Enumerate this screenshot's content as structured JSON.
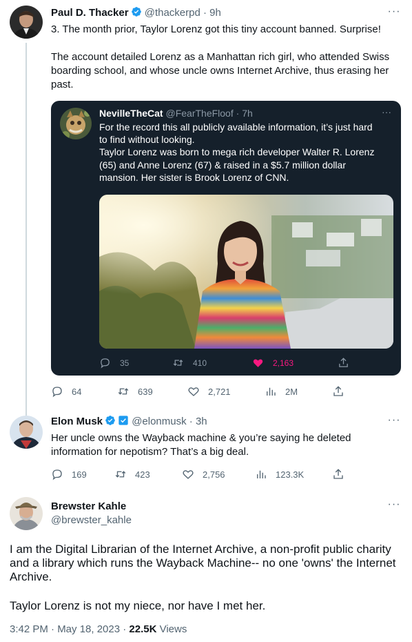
{
  "tweet1": {
    "name": "Paul D. Thacker",
    "handle": "@thackerpd",
    "time": "9h",
    "paragraphs": [
      "3. The month prior, Taylor Lorenz got this tiny account banned. Surprise!",
      "The account detailed Lorenz as a Manhattan rich girl, who attended Swiss boarding school, and whose uncle owns Internet Archive, thus erasing her past."
    ],
    "stats": {
      "replies": "64",
      "retweets": "639",
      "likes": "2,721",
      "views": "2M"
    }
  },
  "quote": {
    "name": "NevilleTheCat",
    "handle": "@FearTheFloof",
    "time": "7h",
    "lines": [
      "For the record this all publicly available information, it’s just hard",
      "to find without looking.",
      "Taylor Lorenz was born to mega rich developer Walter R. Lorenz",
      "(65) and Anne Lorenz (67) & raised in a $5.7 million dollar",
      "mansion. Her sister is Brook Lorenz of CNN."
    ],
    "stats": {
      "replies": "35",
      "retweets": "410",
      "likes": "2,163"
    }
  },
  "tweet2": {
    "name": "Elon Musk",
    "handle": "@elonmusk",
    "time": "3h",
    "text": "Her uncle owns the Wayback machine & you’re saying he deleted information for nepotism? That’s a big deal.",
    "stats": {
      "replies": "169",
      "retweets": "423",
      "likes": "2,756",
      "views": "123.3K"
    }
  },
  "main": {
    "name": "Brewster Kahle",
    "handle": "@brewster_kahle",
    "paragraphs": [
      "I am the Digital Librarian of the Internet Archive, a non-profit public charity and a library which runs the Wayback Machine-- no one 'owns' the Internet Archive.",
      "Taylor Lorenz is not my niece, nor have I met her."
    ],
    "timestamp": "3:42 PM · May 18, 2023 · ",
    "views_count": "22.5K",
    "views_label": " Views"
  },
  "icons": {
    "reply": "reply-icon",
    "retweet": "retweet-icon",
    "like": "heart-icon",
    "views": "views-icon",
    "share": "share-icon",
    "verified": "verified-badge-icon",
    "more": "more-icon"
  },
  "colors": {
    "verified_blue": "#1d9bf0",
    "like_pink": "#f91880",
    "quote_background": "#15202b"
  }
}
